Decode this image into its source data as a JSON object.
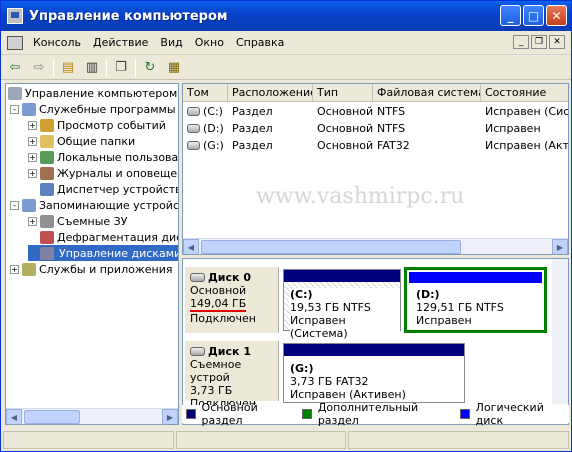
{
  "window": {
    "title": "Управление компьютером",
    "min": "_",
    "max": "□",
    "close": "✕"
  },
  "menu": {
    "items": [
      "Консоль",
      "Действие",
      "Вид",
      "Окно",
      "Справка"
    ]
  },
  "toolbar": {
    "icons": [
      "back-arrow-icon",
      "forward-arrow-icon",
      "up-folder-icon",
      "show-tree-icon",
      "properties-icon",
      "help-icon",
      "refresh-icon",
      "export-icon"
    ]
  },
  "tree": {
    "root": "Управление компьютером (л",
    "items": [
      {
        "label": "Служебные программы",
        "level": 1,
        "pm": "-"
      },
      {
        "label": "Просмотр событий",
        "level": 2,
        "pm": "+"
      },
      {
        "label": "Общие папки",
        "level": 2,
        "pm": "+"
      },
      {
        "label": "Локальные пользова",
        "level": 2,
        "pm": "+"
      },
      {
        "label": "Журналы и оповещен",
        "level": 2,
        "pm": "+"
      },
      {
        "label": "Диспетчер устройств",
        "level": 2,
        "pm": ""
      },
      {
        "label": "Запоминающие устройст",
        "level": 1,
        "pm": "-"
      },
      {
        "label": "Съемные ЗУ",
        "level": 2,
        "pm": "+"
      },
      {
        "label": "Дефрагментация дис",
        "level": 2,
        "pm": ""
      },
      {
        "label": "Управление дисками",
        "level": 2,
        "pm": "",
        "selected": true
      },
      {
        "label": "Службы и приложения",
        "level": 1,
        "pm": "+"
      }
    ]
  },
  "volumes": {
    "headers": [
      "Том",
      "Расположение",
      "Тип",
      "Файловая система",
      "Состояние"
    ],
    "rows": [
      [
        "(C:)",
        "Раздел",
        "Основной",
        "NTFS",
        "Исправен (Систе"
      ],
      [
        "(D:)",
        "Раздел",
        "Основной",
        "NTFS",
        "Исправен"
      ],
      [
        "(G:)",
        "Раздел",
        "Основной",
        "FAT32",
        "Исправен (Актив"
      ]
    ]
  },
  "watermark": "www.vashmirpc.ru",
  "disks": [
    {
      "name": "Диск 0",
      "type": "Основной",
      "size": "149,04 ГБ",
      "status": "Подключен",
      "partitions": [
        {
          "label": "(C:)",
          "size": "19,53 ГБ NTFS",
          "state": "Исправен (Система)"
        },
        {
          "label": "(D:)",
          "size": "129,51 ГБ NTFS",
          "state": "Исправен"
        }
      ]
    },
    {
      "name": "Диск 1",
      "type": "Съемное устрой",
      "size": "3,73 ГБ",
      "status": "Подключен",
      "partitions": [
        {
          "label": "(G:)",
          "size": "3,73 ГБ FAT32",
          "state": "Исправен (Активен)"
        }
      ]
    }
  ],
  "legend": [
    {
      "label": "Основной раздел",
      "color": "#00007f"
    },
    {
      "label": "Дополнительный раздел",
      "color": "#008000"
    },
    {
      "label": "Логический диск",
      "color": "#0000ff"
    }
  ]
}
